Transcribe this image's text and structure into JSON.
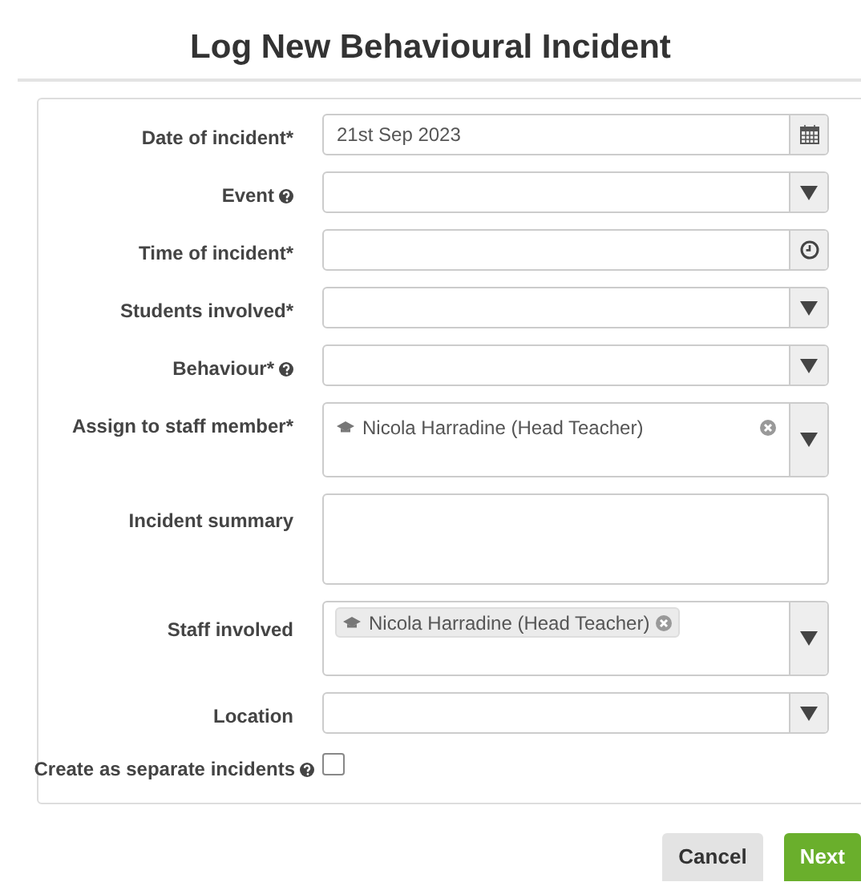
{
  "title": "Log New Behavioural Incident",
  "fields": [
    {
      "label": "Date of incident*",
      "kind": "date",
      "help": false,
      "value": "21st Sep 2023"
    },
    {
      "label": "Event",
      "kind": "select",
      "help": true
    },
    {
      "label": "Time of incident*",
      "kind": "time",
      "help": false
    },
    {
      "label": "Students involved*",
      "kind": "select",
      "help": false
    },
    {
      "label": "Behaviour*",
      "kind": "select",
      "help": true
    },
    {
      "label": "Assign to staff member*",
      "kind": "single-select",
      "help": false,
      "value": "Nicola Harradine (Head Teacher)"
    },
    {
      "label": "Incident summary",
      "kind": "textarea",
      "help": false
    },
    {
      "label": "Staff involved",
      "kind": "multi-select",
      "help": false,
      "tokens": [
        "Nicola Harradine (Head Teacher)"
      ]
    },
    {
      "label": "Location",
      "kind": "select",
      "help": false
    },
    {
      "label": "Create as separate incidents",
      "kind": "checkbox",
      "help": true,
      "checked": false
    }
  ],
  "buttons": [
    {
      "label": "Cancel",
      "kind": "secondary"
    },
    {
      "label": "Next",
      "kind": "primary"
    }
  ]
}
